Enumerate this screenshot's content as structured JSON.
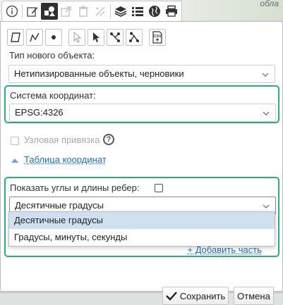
{
  "map": {
    "label": "обла"
  },
  "toolbar": {
    "buttons": [
      {
        "icon": "info-icon"
      },
      {
        "icon": "edit-icon"
      },
      {
        "icon": "shapes-icon",
        "active": true
      },
      {
        "icon": "export-icon"
      },
      {
        "icon": "trash-icon"
      },
      {
        "icon": "split-icon"
      },
      {
        "icon": "layers-icon"
      },
      {
        "icon": "list-icon"
      },
      {
        "icon": "globe-icon"
      },
      {
        "icon": "print-icon"
      }
    ]
  },
  "tools": [
    "polygon-tool",
    "line-tool",
    "point-tool",
    "select-tool",
    "pointer-tool",
    "vertex-edit-tool",
    "vertex-move-tool",
    "csv-import"
  ],
  "csv_label": "CSV",
  "object_type": {
    "label": "Тип нового объекта:",
    "value": "Нетипизированные объекты, черновики"
  },
  "coord_system": {
    "label": "Система координат:",
    "value": "EPSG:4326"
  },
  "snap": {
    "label": "Узловая привязка",
    "help": "?"
  },
  "coord_table": {
    "label": "Таблица координат"
  },
  "angles": {
    "label": "Показать углы и длины ребер:",
    "format_value": "Десятичные градусы",
    "options": [
      "Десятичные градусы",
      "Градусы, минуты, секунды"
    ]
  },
  "add_part": "+ Добавить часть",
  "buttons": {
    "save": "Сохранить",
    "cancel": "Отмена"
  },
  "colors": {
    "accent": "#2fa884",
    "link": "#1f6fb6",
    "selected_option": "#cfe0f0"
  }
}
